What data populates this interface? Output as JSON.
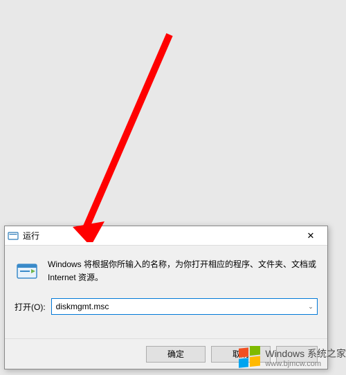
{
  "dialog": {
    "title": "运行",
    "description": "Windows 将根据你所输入的名称，为你打开相应的程序、文件夹、文档或 Internet 资源。",
    "open_label": "打开(O):",
    "input_value": "diskmgmt.msc",
    "buttons": {
      "ok": "确定",
      "cancel": "取消"
    },
    "close_symbol": "✕"
  },
  "icons": {
    "titlebar_run": "run-icon",
    "body_run": "run-app-icon",
    "dropdown": "chevron-down-icon"
  },
  "watermark": {
    "title": "Windows 系统之家",
    "url": "www.bjmcw.com"
  }
}
